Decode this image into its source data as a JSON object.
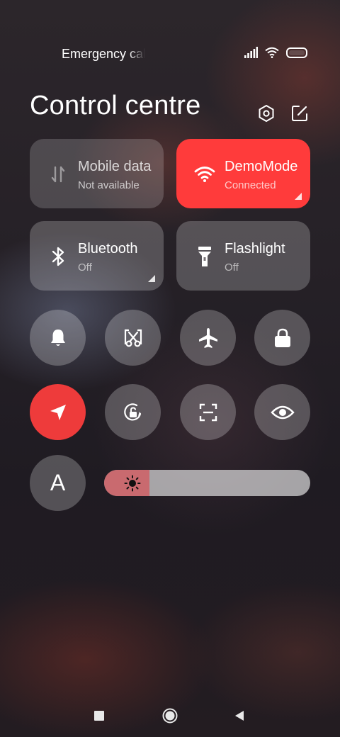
{
  "status_bar": {
    "carrier_text": "Emergency calls only",
    "icons": [
      "signal-icon",
      "wifi-icon",
      "battery-icon"
    ]
  },
  "header": {
    "title": "Control centre",
    "icons": [
      "settings-icon",
      "edit-icon"
    ]
  },
  "tiles": {
    "mobile_data": {
      "title": "Mobile data",
      "subtitle": "Not available",
      "icon": "mobile-data-icon",
      "active": false
    },
    "wifi": {
      "title": "DemoMode",
      "subtitle": "Connected",
      "icon": "wifi-icon",
      "active": true
    },
    "bluetooth": {
      "title": "Bluetooth",
      "subtitle": "Off",
      "icon": "bluetooth-icon",
      "active": false
    },
    "flashlight": {
      "title": "Flashlight",
      "subtitle": "Off",
      "icon": "flashlight-icon",
      "active": false
    }
  },
  "toggles": [
    {
      "name": "ringer",
      "icon": "bell-icon",
      "active": false
    },
    {
      "name": "screenshot",
      "icon": "scissors-icon",
      "active": false
    },
    {
      "name": "airplane-mode",
      "icon": "airplane-icon",
      "active": false
    },
    {
      "name": "lock-screen",
      "icon": "lock-icon",
      "active": false
    },
    {
      "name": "location",
      "icon": "location-arrow-icon",
      "active": true
    },
    {
      "name": "rotation-lock",
      "icon": "rotation-lock-icon",
      "active": false
    },
    {
      "name": "scanner",
      "icon": "scan-icon",
      "active": false
    },
    {
      "name": "reading-mode",
      "icon": "eye-icon",
      "active": false
    }
  ],
  "font_button": {
    "label": "A"
  },
  "brightness": {
    "level_fraction": 0.22,
    "icon": "sun-icon"
  },
  "colors": {
    "accent": "#ff3b3b",
    "location_active": "#ee3b3b",
    "brightness_fill": "#c96a6f"
  },
  "nav_bar": {
    "icons": [
      "recents-icon",
      "home-icon",
      "back-icon"
    ]
  }
}
